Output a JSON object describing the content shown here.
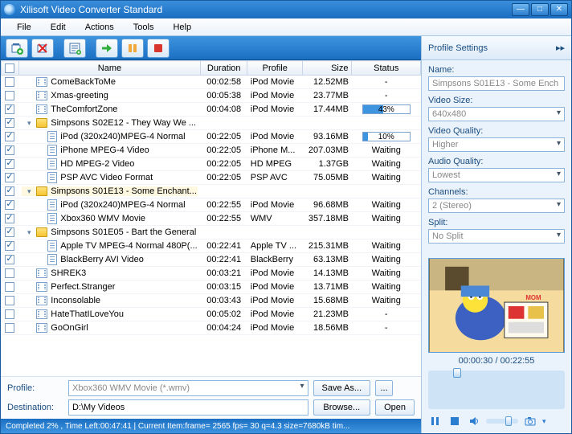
{
  "app": {
    "title": "Xilisoft Video Converter Standard"
  },
  "menu": [
    "File",
    "Edit",
    "Actions",
    "Tools",
    "Help"
  ],
  "toolbar": {
    "add_file": "add-file",
    "remove": "remove",
    "info": "info",
    "start": "start",
    "pause": "pause",
    "stop": "stop"
  },
  "columns": {
    "chk": "",
    "name": "Name",
    "duration": "Duration",
    "profile": "Profile",
    "size": "Size",
    "status": "Status"
  },
  "rows": [
    {
      "chk": false,
      "indent": 1,
      "icon": "video",
      "name": "ComeBackToMe",
      "dur": "00:02:58",
      "prof": "iPod Movie",
      "size": "12.52MB",
      "status": "-"
    },
    {
      "chk": false,
      "indent": 1,
      "icon": "video",
      "name": "Xmas-greeting",
      "dur": "00:05:38",
      "prof": "iPod Movie",
      "size": "23.77MB",
      "status": "-"
    },
    {
      "chk": true,
      "indent": 1,
      "icon": "video",
      "name": "TheComfortZone",
      "dur": "00:04:08",
      "prof": "iPod Movie",
      "size": "17.44MB",
      "status": {
        "progress": 43,
        "text": "43%"
      }
    },
    {
      "chk": true,
      "indent": 0,
      "icon": "folder",
      "group": true,
      "name": "Simpsons S02E12 - They Way We ...",
      "dur": "",
      "prof": "",
      "size": "",
      "status": ""
    },
    {
      "chk": true,
      "indent": 2,
      "icon": "file",
      "name": "iPod (320x240)MPEG-4 Normal",
      "dur": "00:22:05",
      "prof": "iPod Movie",
      "size": "93.16MB",
      "status": {
        "progress": 10,
        "text": "10%"
      }
    },
    {
      "chk": true,
      "indent": 2,
      "icon": "file",
      "name": "iPhone MPEG-4 Video",
      "dur": "00:22:05",
      "prof": "iPhone M...",
      "size": "207.03MB",
      "status": "Waiting"
    },
    {
      "chk": true,
      "indent": 2,
      "icon": "file",
      "name": "HD MPEG-2 Video",
      "dur": "00:22:05",
      "prof": "HD MPEG",
      "size": "1.37GB",
      "status": "Waiting"
    },
    {
      "chk": true,
      "indent": 2,
      "icon": "file",
      "name": "PSP AVC Video Format",
      "dur": "00:22:05",
      "prof": "PSP AVC",
      "size": "75.05MB",
      "status": "Waiting"
    },
    {
      "chk": true,
      "indent": 0,
      "icon": "folder",
      "group": true,
      "sel": true,
      "name": "Simpsons S01E13 - Some Enchant...",
      "dur": "",
      "prof": "",
      "size": "",
      "status": ""
    },
    {
      "chk": true,
      "indent": 2,
      "icon": "file",
      "name": "iPod (320x240)MPEG-4 Normal",
      "dur": "00:22:55",
      "prof": "iPod Movie",
      "size": "96.68MB",
      "status": "Waiting"
    },
    {
      "chk": true,
      "indent": 2,
      "icon": "file",
      "name": "Xbox360 WMV Movie",
      "dur": "00:22:55",
      "prof": "WMV",
      "size": "357.18MB",
      "status": "Waiting"
    },
    {
      "chk": true,
      "indent": 0,
      "icon": "folder",
      "group": true,
      "name": "Simpsons S01E05 - Bart the General",
      "dur": "",
      "prof": "",
      "size": "",
      "status": ""
    },
    {
      "chk": true,
      "indent": 2,
      "icon": "file",
      "name": "Apple TV MPEG-4 Normal 480P(...",
      "dur": "00:22:41",
      "prof": "Apple TV ...",
      "size": "215.31MB",
      "status": "Waiting"
    },
    {
      "chk": true,
      "indent": 2,
      "icon": "file",
      "name": "BlackBerry AVI Video",
      "dur": "00:22:41",
      "prof": "BlackBerry",
      "size": "63.13MB",
      "status": "Waiting"
    },
    {
      "chk": false,
      "indent": 1,
      "icon": "video",
      "name": "SHREK3",
      "dur": "00:03:21",
      "prof": "iPod Movie",
      "size": "14.13MB",
      "status": "Waiting"
    },
    {
      "chk": false,
      "indent": 1,
      "icon": "video",
      "name": "Perfect.Stranger",
      "dur": "00:03:15",
      "prof": "iPod Movie",
      "size": "13.71MB",
      "status": "Waiting"
    },
    {
      "chk": false,
      "indent": 1,
      "icon": "video",
      "name": "Inconsolable",
      "dur": "00:03:43",
      "prof": "iPod Movie",
      "size": "15.68MB",
      "status": "Waiting"
    },
    {
      "chk": false,
      "indent": 1,
      "icon": "video",
      "name": "HateThatILoveYou",
      "dur": "00:05:02",
      "prof": "iPod Movie",
      "size": "21.23MB",
      "status": "-"
    },
    {
      "chk": false,
      "indent": 1,
      "icon": "video",
      "name": "GoOnGirl",
      "dur": "00:04:24",
      "prof": "iPod Movie",
      "size": "18.56MB",
      "status": "-"
    }
  ],
  "bottom": {
    "profile_label": "Profile:",
    "profile_value": "Xbox360 WMV Movie (*.wmv)",
    "saveas": "Save As...",
    "dots": "...",
    "dest_label": "Destination:",
    "dest_value": "D:\\My Videos",
    "browse": "Browse...",
    "open": "Open"
  },
  "status": {
    "text": "Completed 2% , Time Left:00:47:41 | Current Item:frame= 2565 fps= 30 q=4.3 size=7680kB tim..."
  },
  "panel": {
    "header": "Profile Settings",
    "name_label": "Name:",
    "name_value": "Simpsons S01E13 - Some Ench",
    "vsize_label": "Video Size:",
    "vsize_value": "640x480",
    "vq_label": "Video Quality:",
    "vq_value": "Higher",
    "aq_label": "Audio Quality:",
    "aq_value": "Lowest",
    "ch_label": "Channels:",
    "ch_value": "2 (Stereo)",
    "split_label": "Split:",
    "split_value": "No Split",
    "time": "00:00:30 / 00:22:55"
  }
}
